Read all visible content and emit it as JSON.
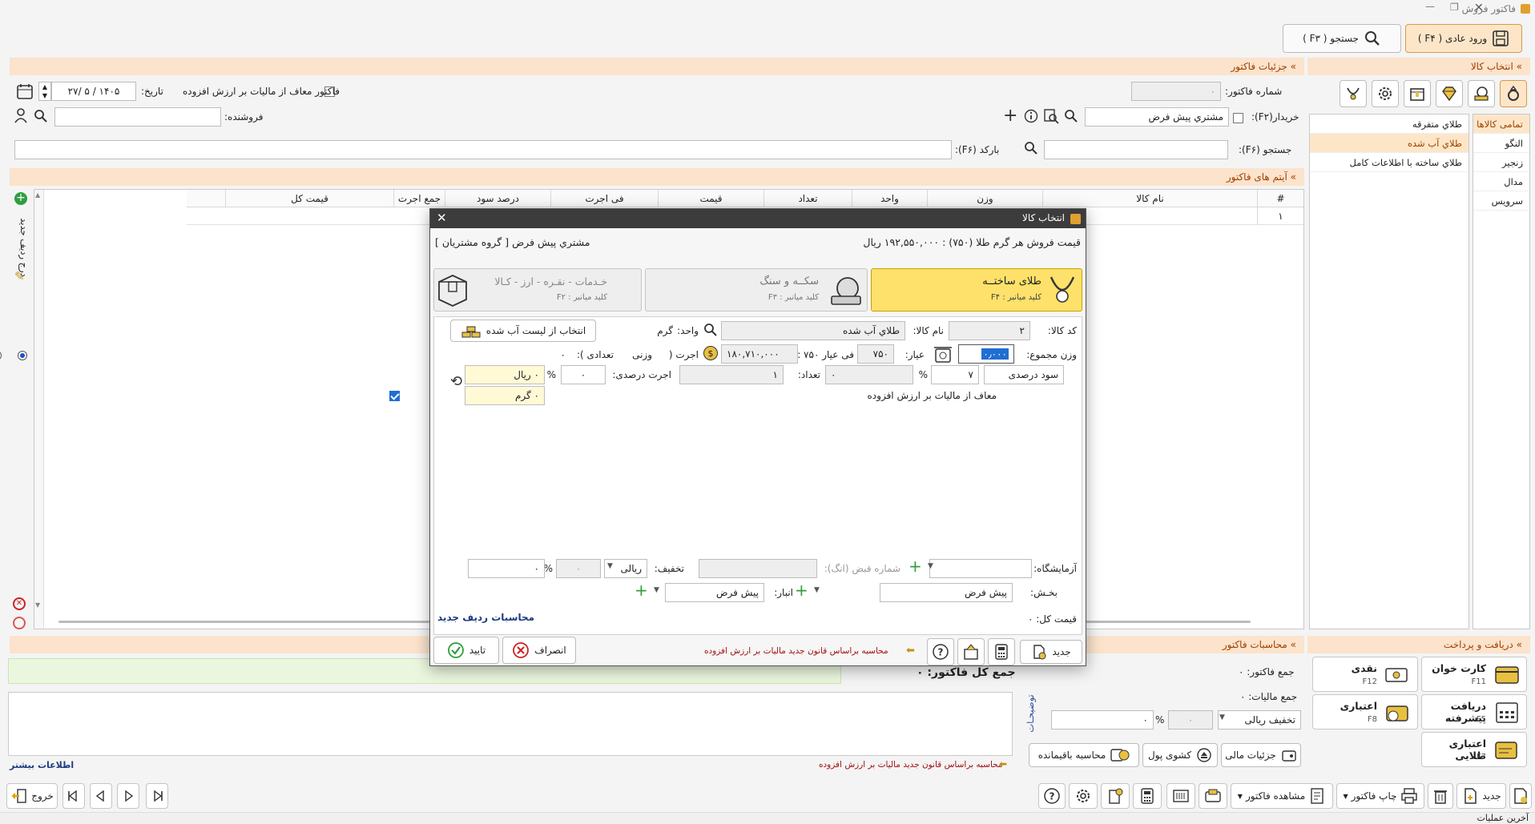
{
  "window": {
    "title": "فاکتور فروش"
  },
  "top_tabs": {
    "normal_entry": "ورود عادی ( F۴ )",
    "search": "جستجو ( F۳ )"
  },
  "sections": {
    "goods_select": "» انتخاب کالا",
    "invoice_details": "» جزئیات فاکتور",
    "invoice_items": "» آیتم های فاکتور",
    "invoice_calc": "» محاسبات فاکتور",
    "payment": "» دریافت و پرداخت"
  },
  "header": {
    "invoice_no_label": "شماره فاکتور:",
    "invoice_no_value": "۰",
    "vat_exempt_label": "فاکتور معاف از مالیات بر ارزش افزوده",
    "date_label": "تاریخ:",
    "date_value": "۱۴۰۵ / ۵ /۲۷",
    "buyer_label": "خریدار(F۲):",
    "buyer_value": "مشتري پيش فرض",
    "seller_label": "فروشنده:",
    "search_label": "جستجو (F۶):",
    "barcode_label": "بارکد (F۶):"
  },
  "categories": {
    "header": "تمامی کالاها",
    "items": [
      "النگو",
      "زنجیر",
      "مدال",
      "سرویس"
    ]
  },
  "subcategories": [
    "طلاي متفرقه",
    "طلاي آب شده",
    "طلاي ساخته با اطلاعات کامل"
  ],
  "table": {
    "columns": [
      "#",
      "نام کالا",
      "وزن",
      "واحد",
      "تعداد",
      "قیمت",
      "فی اجرت",
      "درصد سود",
      "جمع اجرت",
      "قیمت کل"
    ],
    "rows": [
      [
        "۱",
        "",
        "",
        "",
        "",
        "",
        "",
        "",
        "",
        ""
      ]
    ]
  },
  "left_tools": {
    "add_row": "درج ردیف جدید"
  },
  "dialog": {
    "title": "انتخاب کالا",
    "price_line": "قیمت فروش هر گرم طلا (۷۵۰) : ۱۹۲,۵۵۰,۰۰۰ ریال",
    "customer_line": "مشتري پيش فرض  [ گروه مشتریان ]",
    "types": [
      {
        "name": "طلای ساختــه",
        "key": "کلید میانبر : F۴"
      },
      {
        "name": "سکــه و سنگ",
        "key": "کلید میانبر : F۳"
      },
      {
        "name": "خـدمات - نقـره - ارز - کـالا",
        "key": "کلید میانبر : F۲"
      }
    ],
    "code_label": "کد کالا:",
    "code_value": "۲",
    "name_label": "نام کالا:",
    "name_value": "طلاي آب شده",
    "unit_label": "واحد:",
    "unit_value": "گرم",
    "melted_button": "انتخاب از لیست آب شده",
    "weight_label": "وزن مجموع:",
    "weight_value": "۰٫۰۰۰",
    "karat_label": "عیار:",
    "karat_value": "۷۵۰",
    "price750_label": "فی عیار ۷۵۰ :",
    "price750_value": "۱۸۰,۷۱۰,۰۰۰",
    "wage_label": "اجرت (",
    "wage_weight": "وزنی",
    "wage_count": "تعدادی ):",
    "wage_value": "۰",
    "profit_type": "سود درصدی",
    "profit_value": "۷",
    "pct": "%",
    "count_label": "تعداد:",
    "count_value": "۱",
    "wage_percent_label": "اجرت درصدی:",
    "wage_percent_value": "۰",
    "rial_value": "۰ ریال",
    "gram_value": "۰ گرم",
    "vat_exempt": "معاف از مالیات بر ارزش افزوده",
    "lab_label": "آزمایشگاه:",
    "receipt_label": "شماره قبض (انگ):",
    "discount_label": "تخفیف:",
    "discount_type": "ریالی",
    "discount_value": "۰",
    "discount_pct_value": "۰",
    "section_label": "بخـش:",
    "section_value": "پیش فرض",
    "store_label": "انبار:",
    "store_value": "پیش فرض",
    "total_label": "قیمت کل: ۰",
    "row_calc": "محاسبات ردیف جدید",
    "new_button": "جدید",
    "law_note": "محاسبه براساس قانون جدید مالیات بر ارزش افزوده",
    "cancel_button": "انصراف",
    "ok_button": "تایید"
  },
  "calc": {
    "invoice_sum": "جمع فاکتور: ۰",
    "tax_sum": "جمع مالیات: ۰",
    "grand_total": "جمع کل فاکتور: ۰",
    "discount_type": "تخفیف ریالی",
    "discount_value": "۰",
    "discount_pct": "۰",
    "notes": "توضیحـات",
    "more_info": "اطلاعات بیشتر",
    "law_note": "محاسبه براساس قانون جدید مالیات بر ارزش افزوده"
  },
  "payments": [
    {
      "name": "کارت خوان",
      "key": "F11"
    },
    {
      "name": "نقدی",
      "key": "F12"
    },
    {
      "name": "دریافت پیشرفته",
      "key": "F5"
    },
    {
      "name": "اعتباری",
      "key": "F8"
    },
    {
      "name": "اعتباری طلایی",
      "key": "F7"
    }
  ],
  "pay_buttons": {
    "financial": "جزئیات مالی",
    "drawer": "کشوی پول",
    "remaining": "محاسبه باقیمانده"
  },
  "toolbar": {
    "new": "جدید",
    "print": "چاپ فاکتور",
    "view": "مشاهده فاکتور",
    "exit": "خروج"
  },
  "status": {
    "last_ops": "آخرین عملیات"
  }
}
